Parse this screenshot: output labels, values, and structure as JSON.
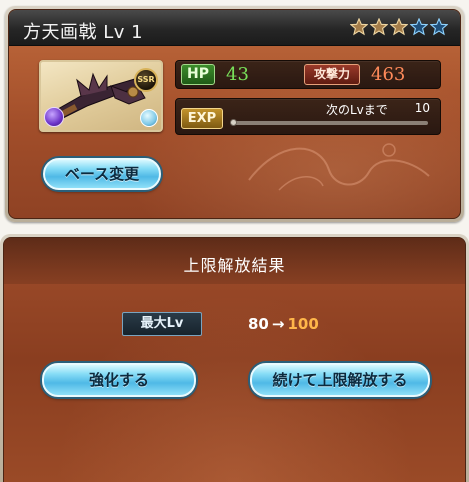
{
  "weapon": {
    "name": "方天画戟 Lv 1",
    "rarity_badge": "SSR",
    "element_icon": "dark-element-icon",
    "skill_icon": "skill-orb-icon",
    "stars": [
      "filled",
      "filled",
      "filled",
      "empty",
      "empty"
    ]
  },
  "stats": {
    "hp_label": "HP",
    "hp_value": "43",
    "atk_label": "攻撃力",
    "atk_value": "463",
    "exp_label": "EXP",
    "exp_caption": "次のLvまで",
    "exp_remaining": "10",
    "exp_progress": 0.0
  },
  "buttons": {
    "base_change": "ベース変更",
    "upgrade": "強化する",
    "continue_uncap": "続けて上限解放する"
  },
  "result": {
    "title": "上限解放結果",
    "max_lv_label": "最大Lv",
    "lv_from": "80",
    "lv_arrow": "→",
    "lv_to": "100"
  },
  "colors": {
    "hp": "#79e05a",
    "atk": "#ff8a5a",
    "lv_to": "#ffb64a",
    "button_blue": "#4fb9e6"
  }
}
